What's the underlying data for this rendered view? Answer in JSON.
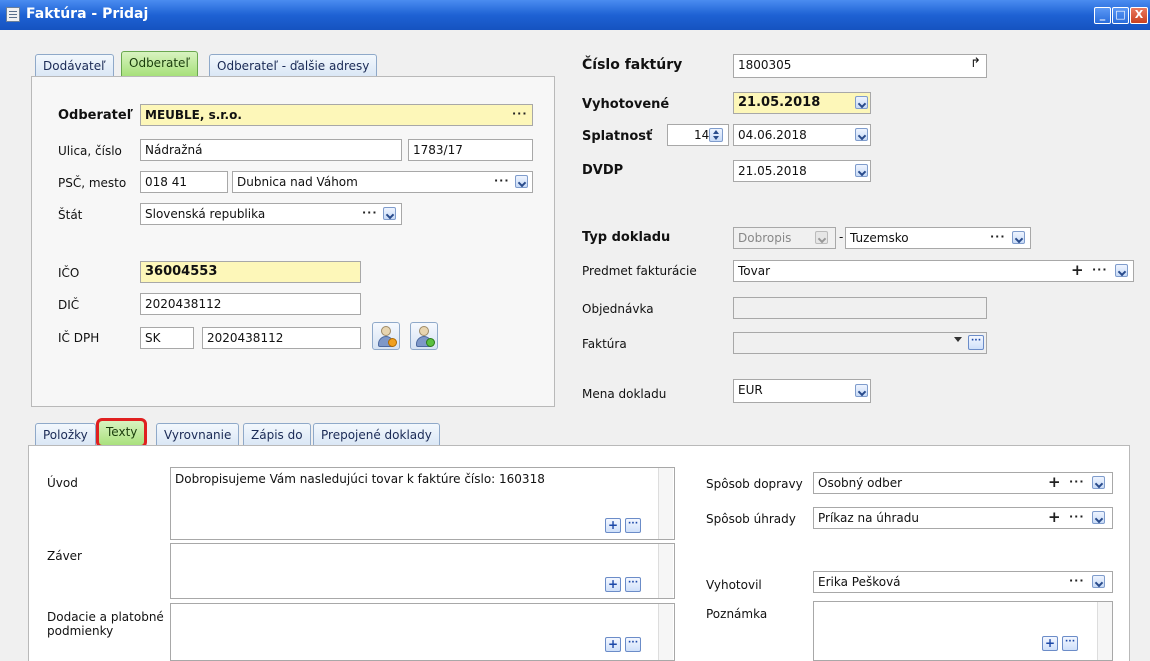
{
  "window": {
    "title": "Faktúra - Pridaj",
    "min": "_",
    "max": "□",
    "close": "X"
  },
  "party_tabs": [
    "Dodávateľ",
    "Odberateľ",
    "Odberateľ - ďalšie adresy"
  ],
  "customer": {
    "odberatel_label": "Odberateľ",
    "odberatel_value": "MEUBLE, s.r.o.",
    "ulica_label": "Ulica, číslo",
    "ulica_value": "Nádražná",
    "cislo_value": "1783/17",
    "psc_label": "PSČ, mesto",
    "psc_value": "018 41",
    "mesto_value": "Dubnica nad Váhom",
    "stat_label": "Štát",
    "stat_value": "Slovenská republika",
    "ico_label": "IČO",
    "ico_value": "36004553",
    "dic_label": "DIČ",
    "dic_value": "2020438112",
    "icdph_label": "IČ DPH",
    "icdph_prefix": "SK",
    "icdph_value": "2020438112"
  },
  "invoice": {
    "cislo_label": "Číslo faktúry",
    "cislo_value": "1800305",
    "vyhotovene_label": "Vyhotovené",
    "vyhotovene_value": "21.05.2018",
    "splatnost_label": "Splatnosť",
    "splatnost_days": "14",
    "splatnost_value": "04.06.2018",
    "dvdp_label": "DVDP",
    "dvdp_value": "21.05.2018",
    "typ_label": "Typ dokladu",
    "typ_value": "Dobropis",
    "typ_dash": "-",
    "typ_sub_value": "Tuzemsko",
    "predmet_label": "Predmet fakturácie",
    "predmet_value": "Tovar",
    "objednavka_label": "Objednávka",
    "objednavka_value": "",
    "faktura_label": "Faktúra",
    "faktura_value": "",
    "mena_label": "Mena dokladu",
    "mena_value": "EUR"
  },
  "detail_tabs": [
    "Položky",
    "Texty",
    "Vyrovnanie",
    "Zápis do",
    "Prepojené doklady"
  ],
  "texty": {
    "uvod_label": "Úvod",
    "uvod_value": "Dobropisujeme Vám nasledujúci tovar k faktúre číslo: 160318",
    "zaver_label": "Záver",
    "zaver_value": "",
    "dodacie_label_1": "Dodacie a platobné",
    "dodacie_label_2": "podmienky",
    "dodacie_value": "",
    "doprava_label": "Spôsob dopravy",
    "doprava_value": "Osobný odber",
    "uhrada_label": "Spôsob úhrady",
    "uhrada_value": "Príkaz na úhradu",
    "vyhotovil_label": "Vyhotovil",
    "vyhotovil_value": "Erika Pešková",
    "poznamka_label": "Poznámka",
    "poznamka_value": ""
  },
  "glyphs": {
    "dots": "···",
    "plus": "+",
    "arrow_redo": "↱"
  },
  "colors": {
    "required_field": "#fdf7b9",
    "active_tab": "#a7e07a",
    "highlight_ring": "#e02020",
    "titlebar": "#1e62d4"
  }
}
